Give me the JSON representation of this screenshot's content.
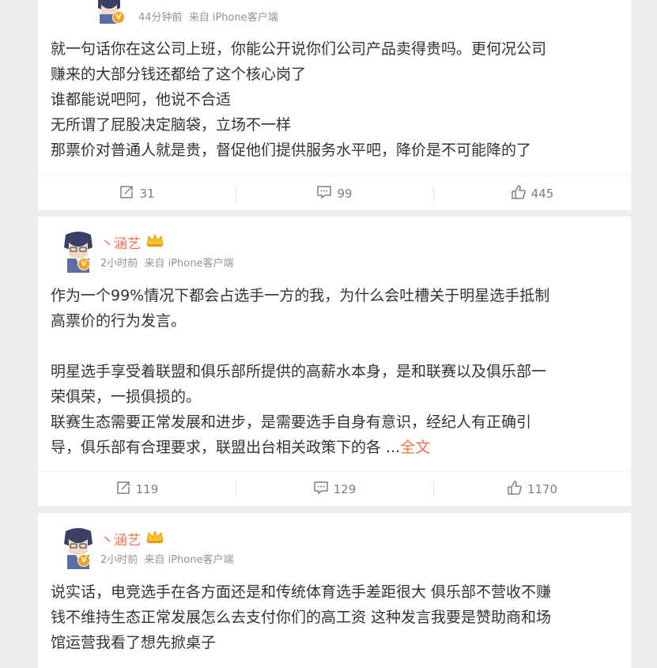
{
  "posts": [
    {
      "time": "44分钟前",
      "source_prefix": "来自",
      "source": "iPhone客户端",
      "lines": [
        "就一句话你在这公司上班，你能公开说你们公司产品卖得贵吗。更何况公司",
        "赚来的大部分钱还都给了这个核心岗了",
        "谁都能说吧阿，他说不合适",
        "无所谓了屁股决定脑袋，立场不一样",
        "那票价对普通人就是贵，督促他们提供服务水平吧，降价是不可能降的了"
      ],
      "reposts": "31",
      "comments": "99",
      "likes": "445"
    },
    {
      "username": "丶涵艺",
      "time": "2小时前",
      "source_prefix": "来自",
      "source": "iPhone客户端",
      "lines": [
        "作为一个99%情况下都会占选手一方的我，为什么会吐槽关于明星选手抵制",
        "高票价的行为发言。",
        "明星选手享受着联盟和俱乐部所提供的高薪水本身，是和联赛以及俱乐部一",
        "荣俱荣，一损俱损的。",
        "联赛生态需要正常发展和进步，是需要选手自身有意识，经纪人有正确引",
        "导，俱乐部有合理要求，联盟出台相关政策下的各 ..."
      ],
      "more_link": "全文",
      "reposts": "119",
      "comments": "129",
      "likes": "1170"
    },
    {
      "username": "丶涵艺",
      "time": "2小时前",
      "source_prefix": "来自",
      "source": "iPhone客户端",
      "lines": [
        "说实话，电竞选手在各方面还是和传统体育选手差距很大 俱乐部不营收不赚",
        "钱不维持生态正常发展怎么去支付你们的高工资 这种发言我要是赞助商和场",
        "馆运营我看了想先掀桌子"
      ]
    }
  ],
  "icons": {
    "repost": "repost-icon",
    "comment": "comment-icon",
    "like": "like-icon",
    "vip": "crown-badge-icon",
    "verified": "verified-v-icon"
  },
  "colors": {
    "username": "#eb7350",
    "link": "#eb7350",
    "meta": "#939393",
    "text": "#333333",
    "vbadge": "#f7a01c",
    "background": "#eeeeee"
  },
  "verified_mark": "V"
}
